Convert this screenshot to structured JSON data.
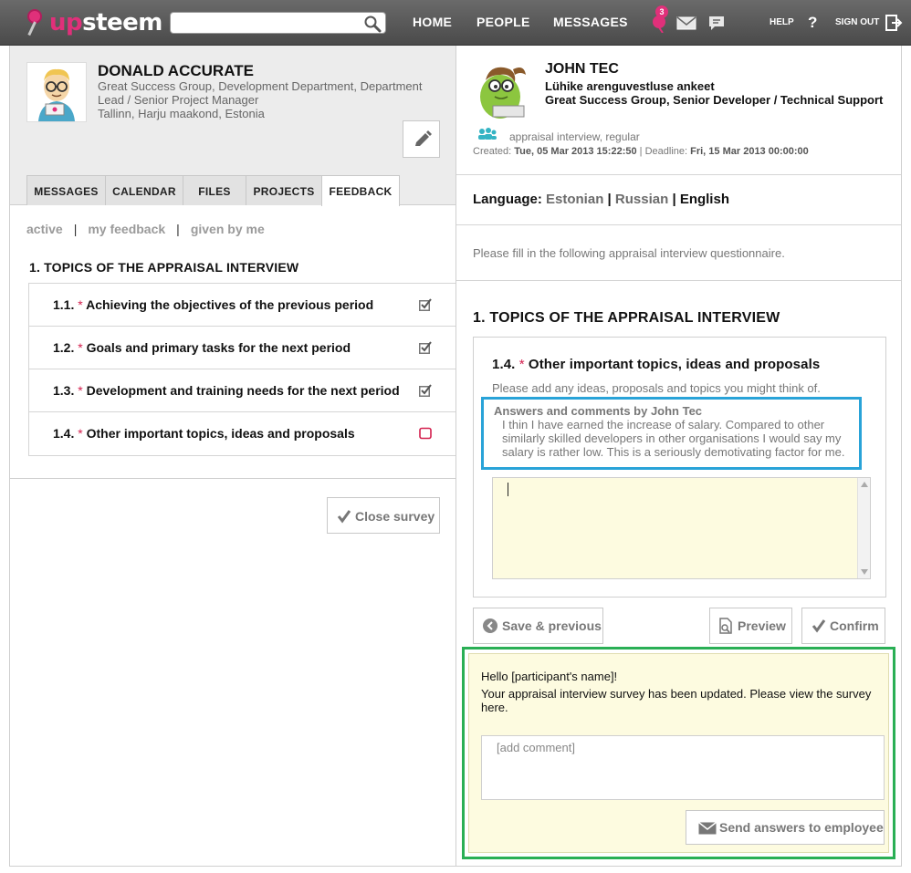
{
  "app": {
    "logo_up": "up",
    "logo_steem": "steem"
  },
  "topbar": {
    "search_placeholder": "",
    "nav": {
      "home": "HOME",
      "people": "PEOPLE",
      "messages": "MESSAGES"
    },
    "notifications_count": "3",
    "help": "HELP",
    "help_symbol": "?",
    "sign_out": "SIGN OUT"
  },
  "left": {
    "person": {
      "name": "DONALD ACCURATE",
      "line1": "Great Success Group, Development Department, Department",
      "line2": "Lead / Senior Project Manager",
      "location": "Tallinn, Harju maakond, Estonia"
    },
    "tabs": [
      {
        "label": "MESSAGES"
      },
      {
        "label": "CALENDAR"
      },
      {
        "label": "FILES"
      },
      {
        "label": "PROJECTS"
      },
      {
        "label": "FEEDBACK"
      }
    ],
    "filters": {
      "active": "active",
      "separator": "|",
      "my_feedback": "my feedback",
      "given_by_me": "given by me"
    },
    "section_title": "1. TOPICS OF THE APPRAISAL INTERVIEW",
    "required_mark": "*",
    "topics": [
      {
        "number": "1.1.",
        "title": "Achieving the objectives of the previous period",
        "done": true
      },
      {
        "number": "1.2.",
        "title": "Goals and primary tasks for the next period",
        "done": true
      },
      {
        "number": "1.3.",
        "title": "Development and training needs for the next period",
        "done": true
      },
      {
        "number": "1.4.",
        "title": "Other important topics, ideas and proposals",
        "done": false
      }
    ],
    "close_survey": "Close survey"
  },
  "right": {
    "person": {
      "name": "JOHN TEC",
      "survey_title": "Lühike arenguvestluse ankeet",
      "role": "Great Success Group, Senior Developer / Technical Support"
    },
    "survey_type": "appraisal interview, regular",
    "created_label": "Created:",
    "created_value": "Tue, 05 Mar 2013 15:22:50",
    "meta_sep": "|",
    "deadline_label": "Deadline:",
    "deadline_value": "Fri, 15 Mar 2013 00:00:00",
    "language_label": "Language:",
    "languages": {
      "et": "Estonian",
      "ru": "Russian",
      "en": "English"
    },
    "lang_sep": "|",
    "intro": "Please fill in the following appraisal interview questionnaire.",
    "section_title": "1. TOPICS OF THE APPRAISAL INTERVIEW",
    "question": {
      "number": "1.4.",
      "required_mark": "*",
      "title": "Other important topics, ideas and proposals",
      "hint": "Please add any ideas, proposals and topics you might think of.",
      "answers_header": "Answers and comments by John Tec",
      "answer_lines": [
        "I thin I have earned the increase of salary. Compared to other",
        "similarly skilled developers in other organisations I would say my",
        "salary is rather low. This is a seriously demotivating factor for me."
      ]
    },
    "buttons": {
      "prev": "Save & previous",
      "preview": "Preview",
      "confirm": "Confirm"
    },
    "notify": {
      "hello": "Hello [participant's name]!",
      "message": "Your appraisal interview survey has been updated. Please view the survey here.",
      "comment_placeholder": "[add comment]",
      "send": "Send answers to employee"
    }
  },
  "colors": {
    "accent_pink": "#e0307a",
    "required_red": "#d3204e",
    "highlight_blue": "#29a3d8",
    "highlight_green": "#2aaf55",
    "note_yellow": "#fdfbe0"
  }
}
